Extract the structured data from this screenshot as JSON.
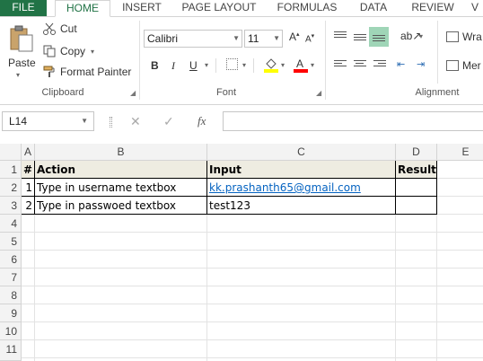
{
  "ribbon_tabs": [
    "FILE",
    "HOME",
    "INSERT",
    "PAGE LAYOUT",
    "FORMULAS",
    "DATA",
    "REVIEW",
    "V"
  ],
  "clipboard": {
    "paste": "Paste",
    "cut": "Cut",
    "copy": "Copy",
    "format_painter": "Format Painter",
    "label": "Clipboard"
  },
  "font": {
    "name": "Calibri",
    "size": "11",
    "label": "Font",
    "bold": "B",
    "italic": "I",
    "underline": "U",
    "font_color": "#ff0000",
    "fill_color": "#ffff00"
  },
  "alignment": {
    "wrap": "Wra",
    "merge": "Mer",
    "label": "Alignment"
  },
  "formula_bar": {
    "name_box": "L14",
    "fx": "fx",
    "formula": ""
  },
  "sheet": {
    "columns": [
      "A",
      "B",
      "C",
      "D",
      "E"
    ],
    "rows": [
      "1",
      "2",
      "3",
      "4",
      "5",
      "6",
      "7",
      "8",
      "9",
      "10",
      "11"
    ],
    "header_row": [
      "#",
      "Action",
      "Input",
      "Result"
    ],
    "data_rows": [
      [
        "1",
        "Type in username textbox",
        "kk.prashanth65@gmail.com",
        ""
      ],
      [
        "2",
        "Type in passwoed textbox",
        "test123",
        ""
      ]
    ]
  },
  "colors": {
    "excel_green": "#217346",
    "header_fill": "#eeece1",
    "hyperlink": "#0563c1"
  }
}
